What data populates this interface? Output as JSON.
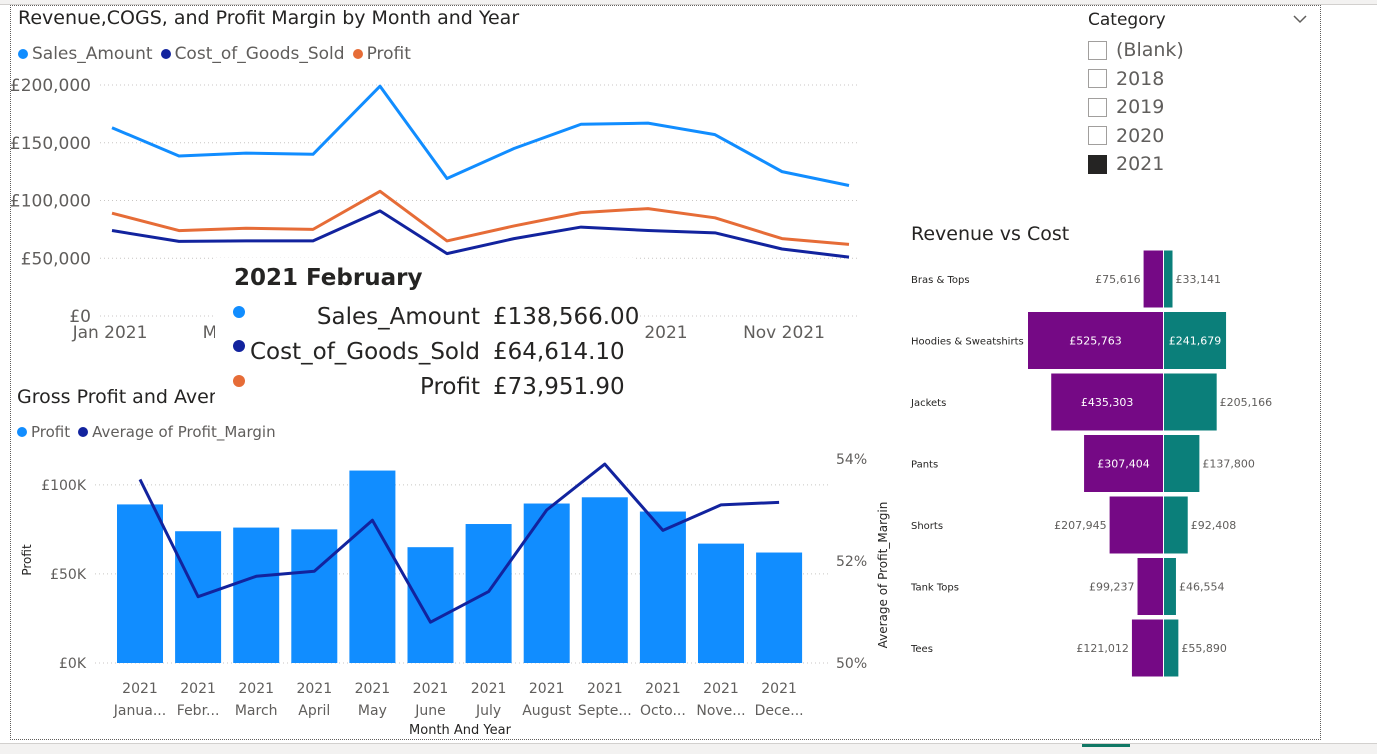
{
  "slicer": {
    "title": "Category",
    "items": [
      {
        "label": "(Blank)",
        "checked": false
      },
      {
        "label": "2018",
        "checked": false
      },
      {
        "label": "2019",
        "checked": false
      },
      {
        "label": "2020",
        "checked": false
      },
      {
        "label": "2021",
        "checked": true
      }
    ]
  },
  "colors": {
    "sales": "#118dff",
    "cogs": "#12239e",
    "profit_line": "#e66c37",
    "profit_bar": "#118dff",
    "margin": "#12239e",
    "revenue_bar": "#750985",
    "cost_bar": "#0b7f7a"
  },
  "tooltip": {
    "title": "2021 February",
    "rows": [
      {
        "name": "Sales_Amount",
        "value": "£138,566.00"
      },
      {
        "name": "Cost_of_Goods_Sold",
        "value": "£64,614.10"
      },
      {
        "name": "Profit",
        "value": "£73,951.90"
      }
    ]
  },
  "chart_data": [
    {
      "type": "line",
      "title": "Revenue,COGS, and Profit Margin by Month and Year",
      "x": [
        "Jan 2021",
        "Feb 2021",
        "Mar 2021",
        "Apr 2021",
        "May 2021",
        "Jun 2021",
        "Jul 2021",
        "Aug 2021",
        "Sep 2021",
        "Oct 2021",
        "Nov 2021",
        "Dec 2021"
      ],
      "x_tick_labels": [
        "Jan 2021",
        "M",
        "",
        "2021",
        "Nov 2021"
      ],
      "y_tick_labels": [
        "£200,000",
        "£150,000",
        "£100,000",
        "£50,000",
        "£0"
      ],
      "ylim": [
        0,
        200000
      ],
      "series": [
        {
          "name": "Sales_Amount",
          "values": [
            163000,
            138566,
            141000,
            140000,
            199000,
            119000,
            145000,
            166000,
            167000,
            157000,
            125000,
            113000
          ]
        },
        {
          "name": "Cost_of_Goods_Sold",
          "values": [
            74000,
            64614,
            65000,
            65000,
            91000,
            54000,
            67000,
            77000,
            74000,
            72000,
            58000,
            51000
          ]
        },
        {
          "name": "Profit",
          "values": [
            89000,
            73952,
            76000,
            75000,
            108000,
            65000,
            78000,
            89500,
            93000,
            85000,
            67000,
            62000
          ]
        }
      ],
      "legend": "top-left",
      "grid": true
    },
    {
      "type": "bar",
      "title": "Gross Profit and Aver",
      "xlabel": "Month And Year",
      "ylabel": "Profit",
      "y2label": "Average of Profit_Margin",
      "categories_year": [
        "2021",
        "2021",
        "2021",
        "2021",
        "2021",
        "2021",
        "2021",
        "2021",
        "2021",
        "2021",
        "2021",
        "2021"
      ],
      "categories": [
        "Janua...",
        "Febr...",
        "March",
        "April",
        "May",
        "June",
        "July",
        "August",
        "Septe...",
        "Octo...",
        "Nove...",
        "Dece..."
      ],
      "y_tick_labels": [
        "£100K",
        "£50K",
        "£0K"
      ],
      "y2_tick_labels": [
        "54%",
        "52%",
        "50%"
      ],
      "ylim": [
        0,
        110000
      ],
      "y2lim": [
        50,
        54
      ],
      "series": [
        {
          "name": "Profit",
          "type": "bar",
          "values": [
            89000,
            73952,
            76000,
            75000,
            108000,
            65000,
            78000,
            89500,
            93000,
            85000,
            67000,
            62000
          ]
        },
        {
          "name": "Average of Profit_Margin",
          "type": "line",
          "values": [
            53.6,
            51.3,
            51.7,
            51.8,
            52.8,
            50.8,
            51.4,
            53.0,
            53.9,
            52.6,
            53.1,
            53.15
          ]
        }
      ],
      "legend": "top-left"
    },
    {
      "type": "bar",
      "title": "Revenue vs Cost",
      "orientation": "horizontal-diverging",
      "categories": [
        "Bras & Tops",
        "Hoodies & Sweatshirts",
        "Jackets",
        "Pants",
        "Shorts",
        "Tank Tops",
        "Tees"
      ],
      "series": [
        {
          "name": "Revenue",
          "values": [
            75616,
            525763,
            435303,
            307404,
            207945,
            99237,
            121012
          ],
          "labels": [
            "£75,616",
            "£525,763",
            "£435,303",
            "£307,404",
            "£207,945",
            "£99,237",
            "£121,012"
          ]
        },
        {
          "name": "Cost",
          "values": [
            33141,
            241679,
            205166,
            137800,
            92408,
            46554,
            55890
          ],
          "labels": [
            "£33,141",
            "£241,679",
            "£205,166",
            "£137,800",
            "£92,408",
            "£46,554",
            "£55,890"
          ]
        }
      ]
    }
  ]
}
